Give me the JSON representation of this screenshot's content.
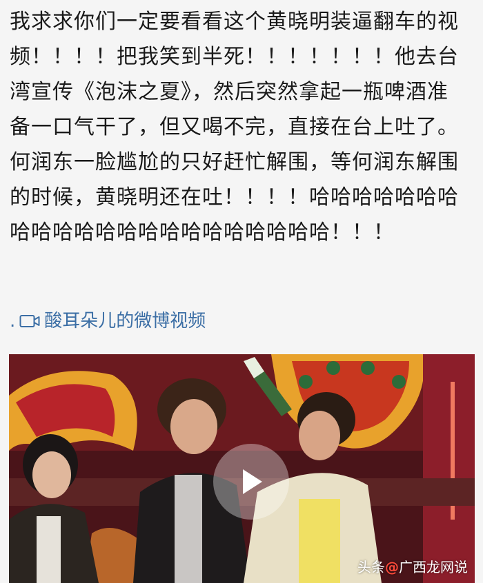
{
  "post": {
    "text": "我求求你们一定要看看这个黄晓明装逼翻车的视频！！！！把我笑到半死！！！！！！！他去台湾宣传《泡沫之夏》，然后突然拿起一瓶啤酒准备一口气干了，但又喝不完，直接在台上吐了。何润东一脸尴尬的只好赶忙解围，等何润东解围的时候，黄晓明还在吐！！！！哈哈哈哈哈哈哈哈哈哈哈哈哈哈哈哈哈哈哈哈哈哈！！！"
  },
  "video_link": {
    "prefix": ".",
    "icon": "video-camera-icon",
    "label": "酸耳朵儿的微博视频"
  },
  "video": {
    "play_icon": "play-icon",
    "watermark_prefix": "头条",
    "watermark_brand": "@",
    "watermark_suffix": "广西龙网说"
  },
  "colors": {
    "link": "#3b6ea5",
    "background": "#f5f5f5",
    "stage_red": "#b8242a",
    "stage_gold": "#e8a22c"
  }
}
